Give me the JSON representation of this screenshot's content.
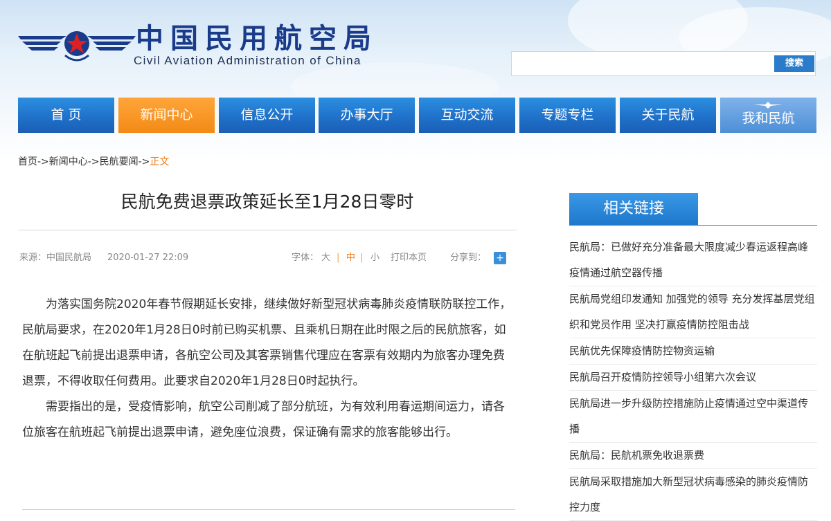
{
  "header": {
    "title": "中国民用航空局",
    "subtitle": "Civil Aviation Administration of China",
    "search": {
      "placeholder": "",
      "button_label": "搜索"
    }
  },
  "nav": [
    {
      "label": "首 页"
    },
    {
      "label": "新闻中心",
      "active": true
    },
    {
      "label": "信息公开"
    },
    {
      "label": "办事大厅"
    },
    {
      "label": "互动交流"
    },
    {
      "label": "专题专栏"
    },
    {
      "label": "关于民航"
    },
    {
      "label": "我和民航"
    }
  ],
  "breadcrumb": {
    "items": [
      "首页",
      "新闻中心",
      "民航要闻"
    ],
    "separator": "->",
    "current": "正文"
  },
  "article": {
    "title": "民航免费退票政策延长至1月28日零时",
    "source": "来源：中国民航局",
    "date": "2020-01-27 22:09",
    "font_label": "字体：",
    "font_large": "大",
    "font_medium": "中",
    "font_small": "小",
    "print_label": "打印本页",
    "share_label": "分享到：",
    "paragraphs": [
      "为落实国务院2020年春节假期延长安排，继续做好新型冠状病毒肺炎疫情联防联控工作，民航局要求，在2020年1月28日0时前已购买机票、且乘机日期在此时限之后的民航旅客，如在航班起飞前提出退票申请，各航空公司及其客票销售代理应在客票有效期内为旅客办理免费退票，不得收取任何费用。此要求自2020年1月28日0时起执行。",
      "需要指出的是，受疫情影响，航空公司削减了部分航班，为有效利用春运期间运力，请各位旅客在航班起飞前提出退票申请，避免座位浪费，保证确有需求的旅客能够出行。"
    ]
  },
  "related": {
    "header": "相关链接",
    "items": [
      "民航局：已做好充分准备最大限度减少春运返程高峰疫情通过航空器传播",
      "民航局党组印发通知 加强党的领导 充分发挥基层党组织和党员作用 坚决打赢疫情防控阻击战",
      "民航优先保障疫情防控物资运输",
      "民航局召开疫情防控领导小组第六次会议",
      "民航局进一步升级防控措施防止疫情通过空中渠道传播",
      "民航局：民航机票免收退票费",
      "民航局采取措施加大新型冠状病毒感染的肺炎疫情防控力度"
    ]
  },
  "colors": {
    "nav_blue": "#1f6fc8",
    "nav_active_orange": "#f38a16",
    "title_blue": "#1a3b8a",
    "breadcrumb_current": "#ee7a12"
  }
}
